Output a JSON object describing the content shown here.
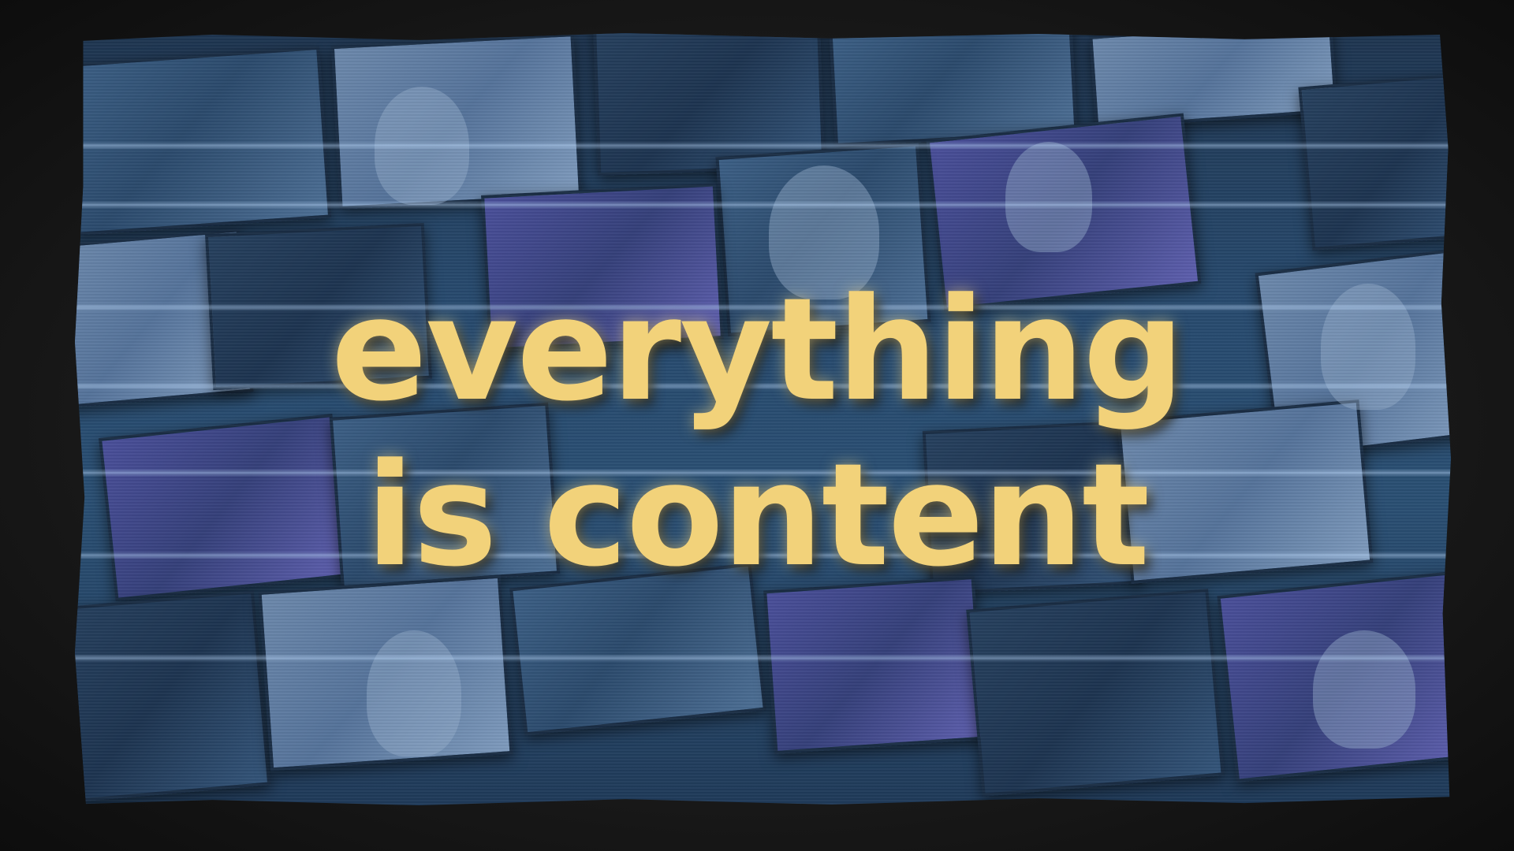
{
  "headline": {
    "line1": "everything",
    "line2": "is content",
    "color": "#f2d27a"
  },
  "background": {
    "description_free": true,
    "frame_color": "#1c1c1c",
    "screen_tint": "#274a6e"
  }
}
